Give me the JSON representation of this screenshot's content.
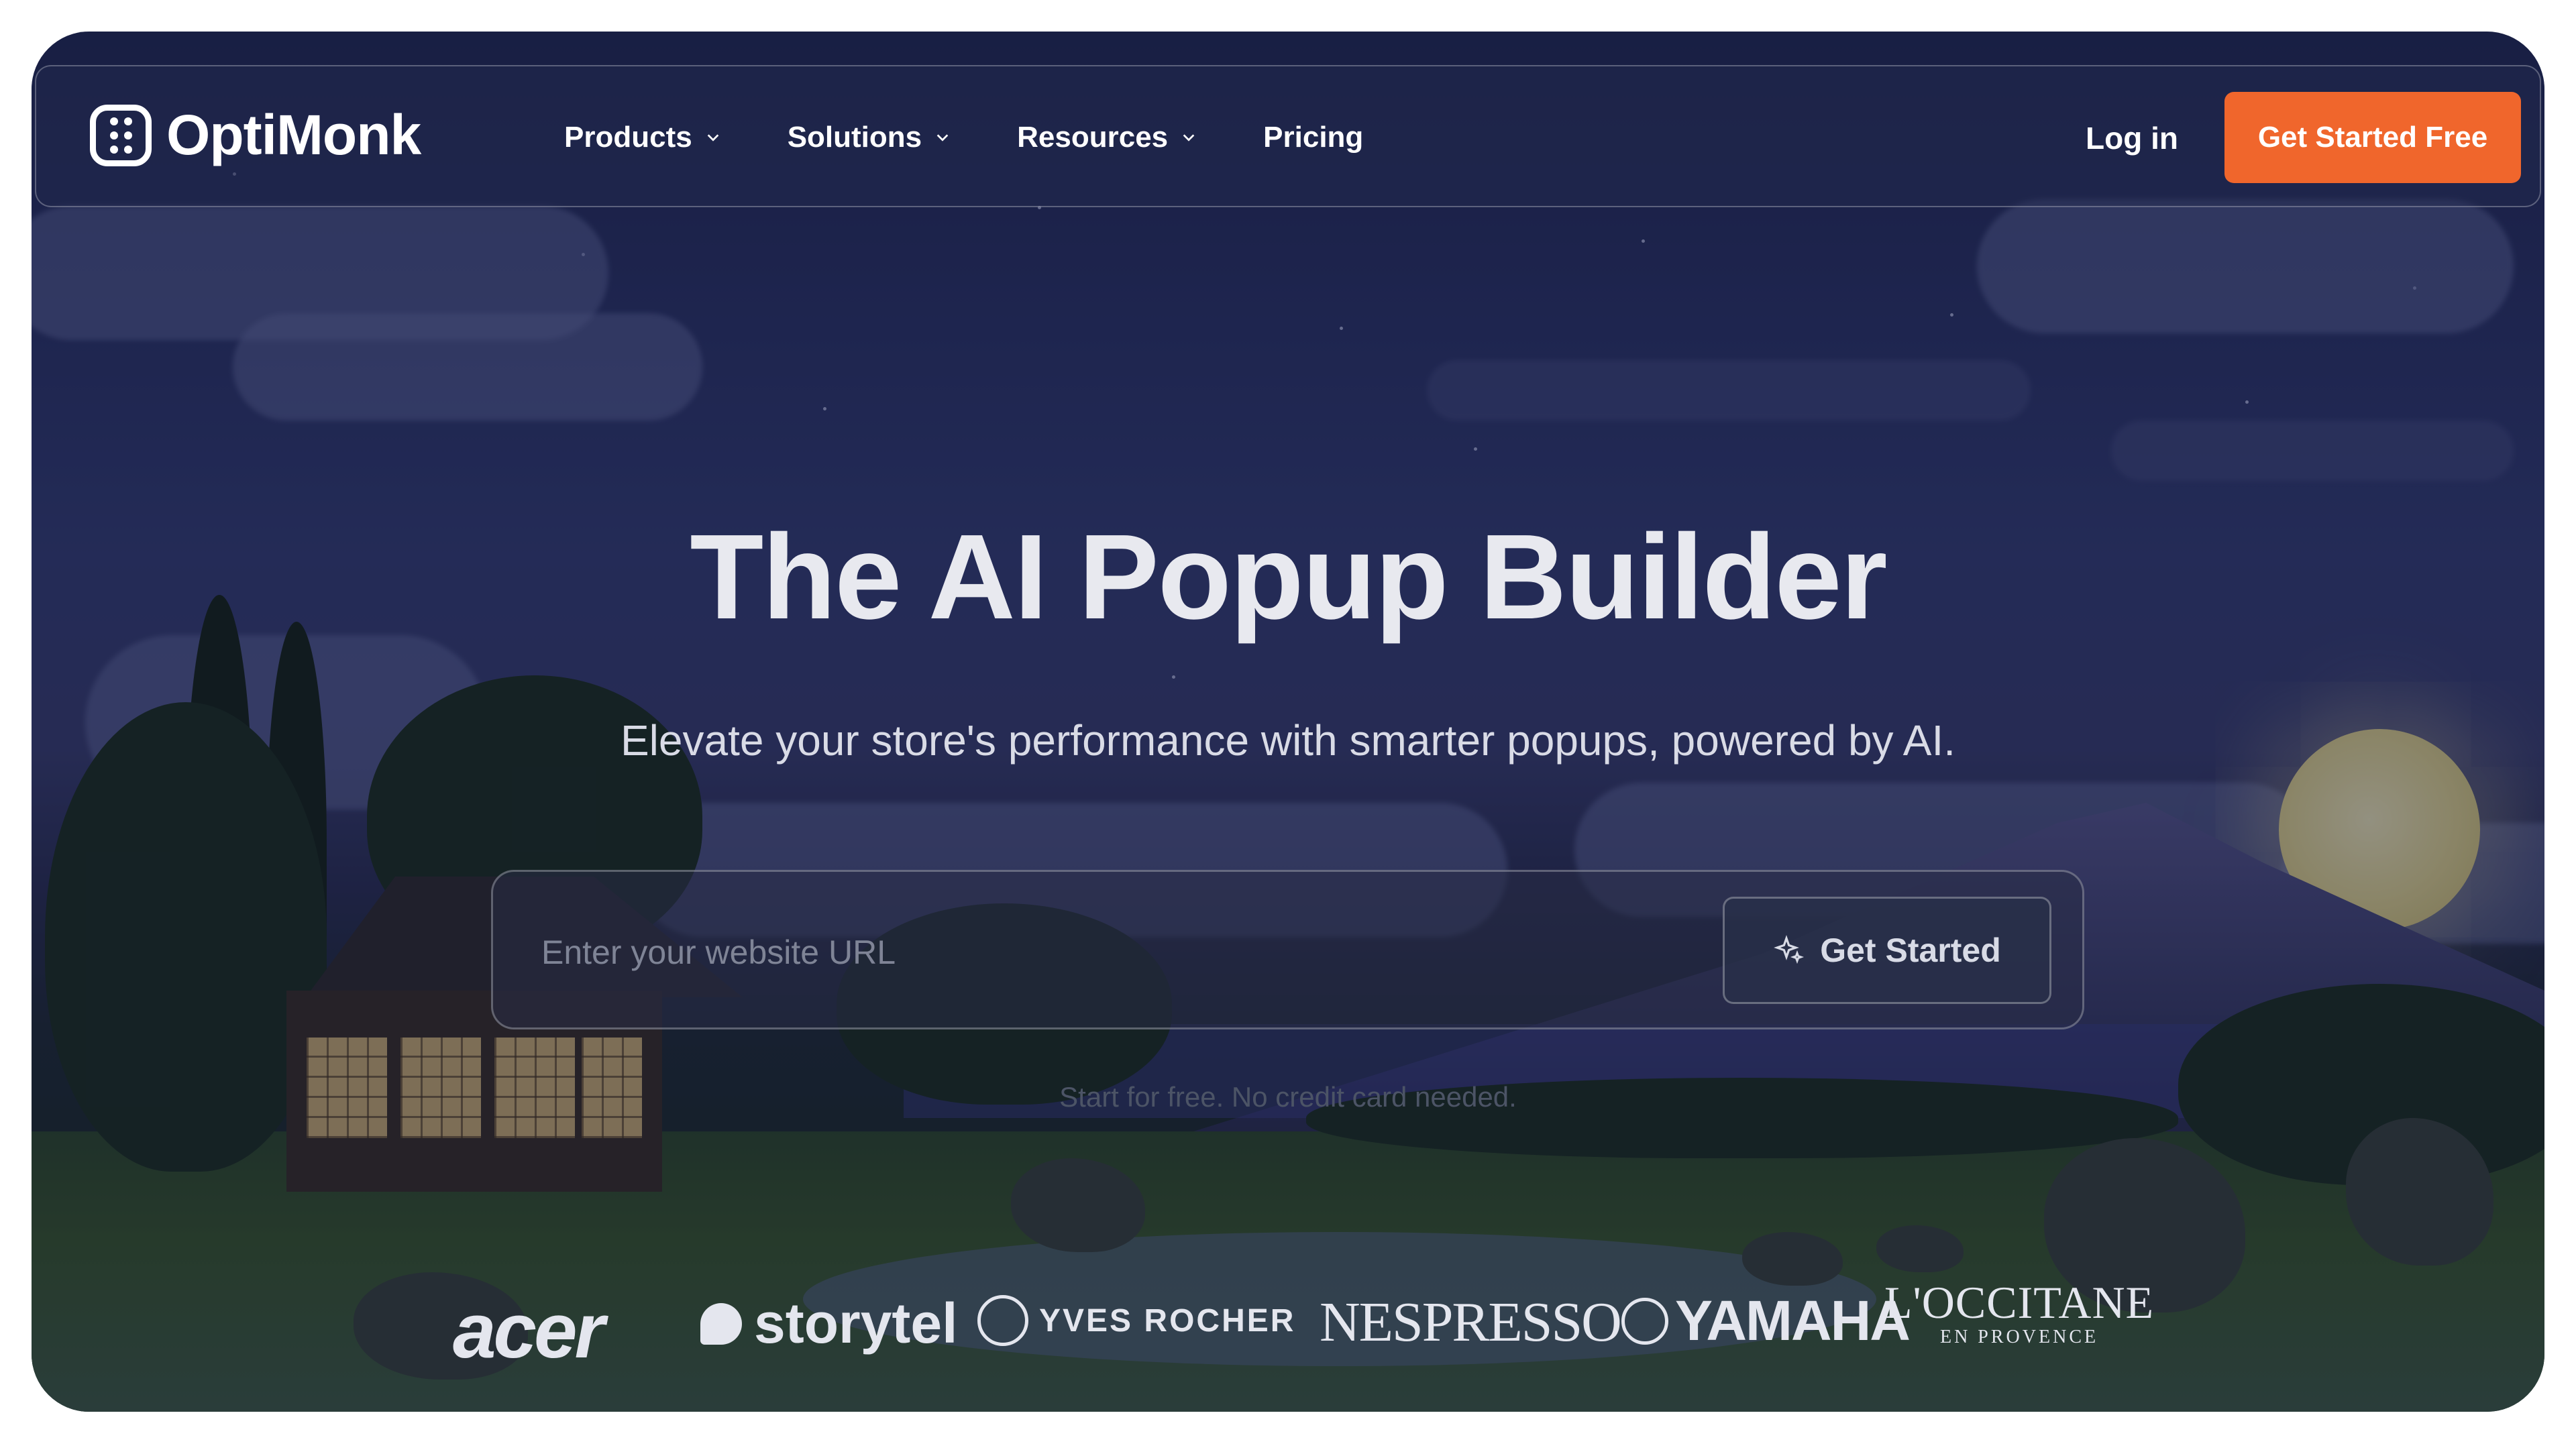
{
  "brand": {
    "name": "OptiMonk"
  },
  "nav": {
    "items": [
      {
        "label": "Products",
        "has_dropdown": true
      },
      {
        "label": "Solutions",
        "has_dropdown": true
      },
      {
        "label": "Resources",
        "has_dropdown": true
      },
      {
        "label": "Pricing",
        "has_dropdown": false
      }
    ],
    "login_label": "Log in",
    "cta_label": "Get Started Free"
  },
  "hero": {
    "title": "The AI Popup Builder",
    "subtitle": "Elevate your store's performance with smarter popups, powered by AI.",
    "url_placeholder": "Enter your website URL",
    "url_value": "",
    "start_button_label": "Get Started",
    "hint": "Start for free. No credit card needed."
  },
  "clients": {
    "logos": [
      {
        "name": "acer",
        "text": "acer"
      },
      {
        "name": "storytel",
        "text": "storytel"
      },
      {
        "name": "yves-rocher",
        "text": "YVES ROCHER"
      },
      {
        "name": "nespresso",
        "text": "NESPRESSO"
      },
      {
        "name": "yamaha",
        "text": "YAMAHA"
      },
      {
        "name": "loccitane",
        "text": "L'OCCITANE",
        "subtext": "EN PROVENCE"
      }
    ]
  },
  "colors": {
    "cta": "#f0662c",
    "text_primary": "#ffffff",
    "hero_text": "#e8e9ef"
  },
  "icons": {
    "dropdown": "chevron-down-icon",
    "start_button": "sparkle-icon",
    "logo": "optimonk-logo-icon"
  }
}
